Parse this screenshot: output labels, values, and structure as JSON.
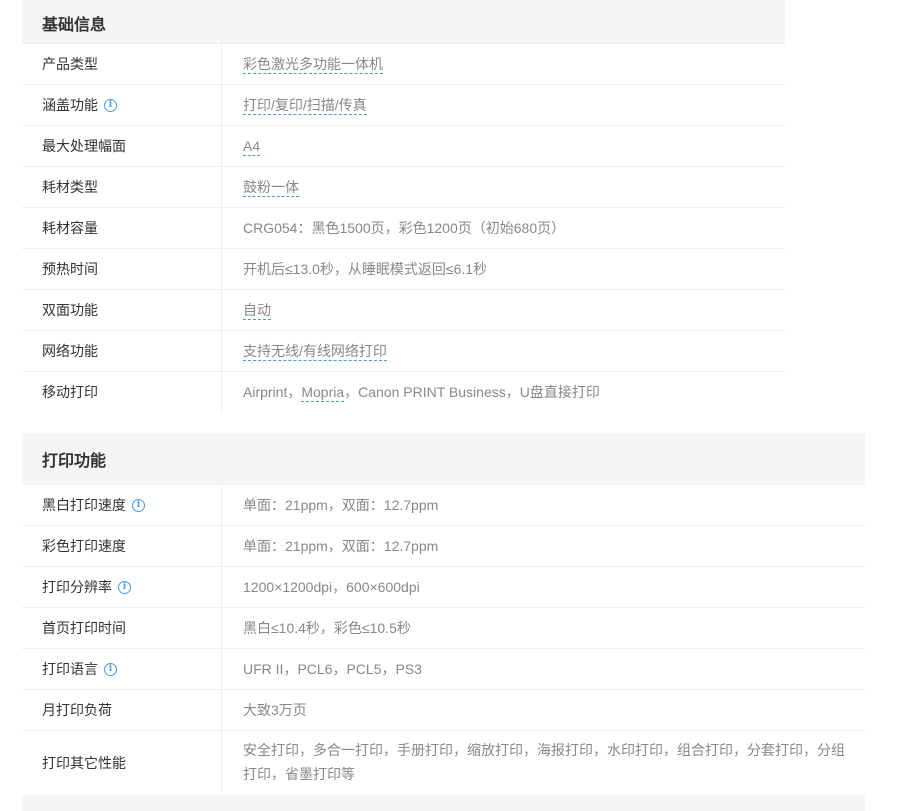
{
  "basic": {
    "title": "基础信息",
    "rows": [
      {
        "label": "产品类型",
        "value": "彩色激光多功能一体机"
      },
      {
        "label": "涵盖功能",
        "value": "打印/复印/扫描/传真"
      },
      {
        "label": "最大处理幅面",
        "value": "A4"
      },
      {
        "label": "耗材类型",
        "value": "鼓粉一体"
      },
      {
        "label": "耗材容量",
        "value": "CRG054：黑色1500页，彩色1200页（初始680页）"
      },
      {
        "label": "预热时间",
        "value": "开机后≤13.0秒，从睡眠模式返回≤6.1秒"
      },
      {
        "label": "双面功能",
        "value": "自动"
      },
      {
        "label": "网络功能",
        "value": "支持无线/有线网络打印"
      },
      {
        "label": "移动打印",
        "value_pre": "Airprint，",
        "value_link": "Mopria",
        "value_post": "，Canon PRINT Business，U盘直接打印"
      }
    ]
  },
  "print": {
    "title": "打印功能",
    "rows": [
      {
        "label": "黑白打印速度",
        "value": "单面：21ppm，双面：12.7ppm"
      },
      {
        "label": "彩色打印速度",
        "value": "单面：21ppm，双面：12.7ppm"
      },
      {
        "label": "打印分辨率",
        "value": "1200×1200dpi，600×600dpi"
      },
      {
        "label": "首页打印时间",
        "value": "黑白≤10.4秒，彩色≤10.5秒"
      },
      {
        "label": "打印语言",
        "value": "UFR II，PCL6，PCL5，PS3"
      },
      {
        "label": "月打印负荷",
        "value": "大致3万页"
      },
      {
        "label": "打印其它性能",
        "value": "安全打印，多合一打印，手册打印，缩放打印，海报打印，水印打印，组合打印，分套打印，分组打印，省墨打印等"
      }
    ]
  },
  "info_icon_glyph": "i",
  "colors": {
    "accent": "#4a9ae8",
    "header_bg": "#f5f5f5",
    "label_text": "#333333",
    "value_text": "#888888"
  }
}
